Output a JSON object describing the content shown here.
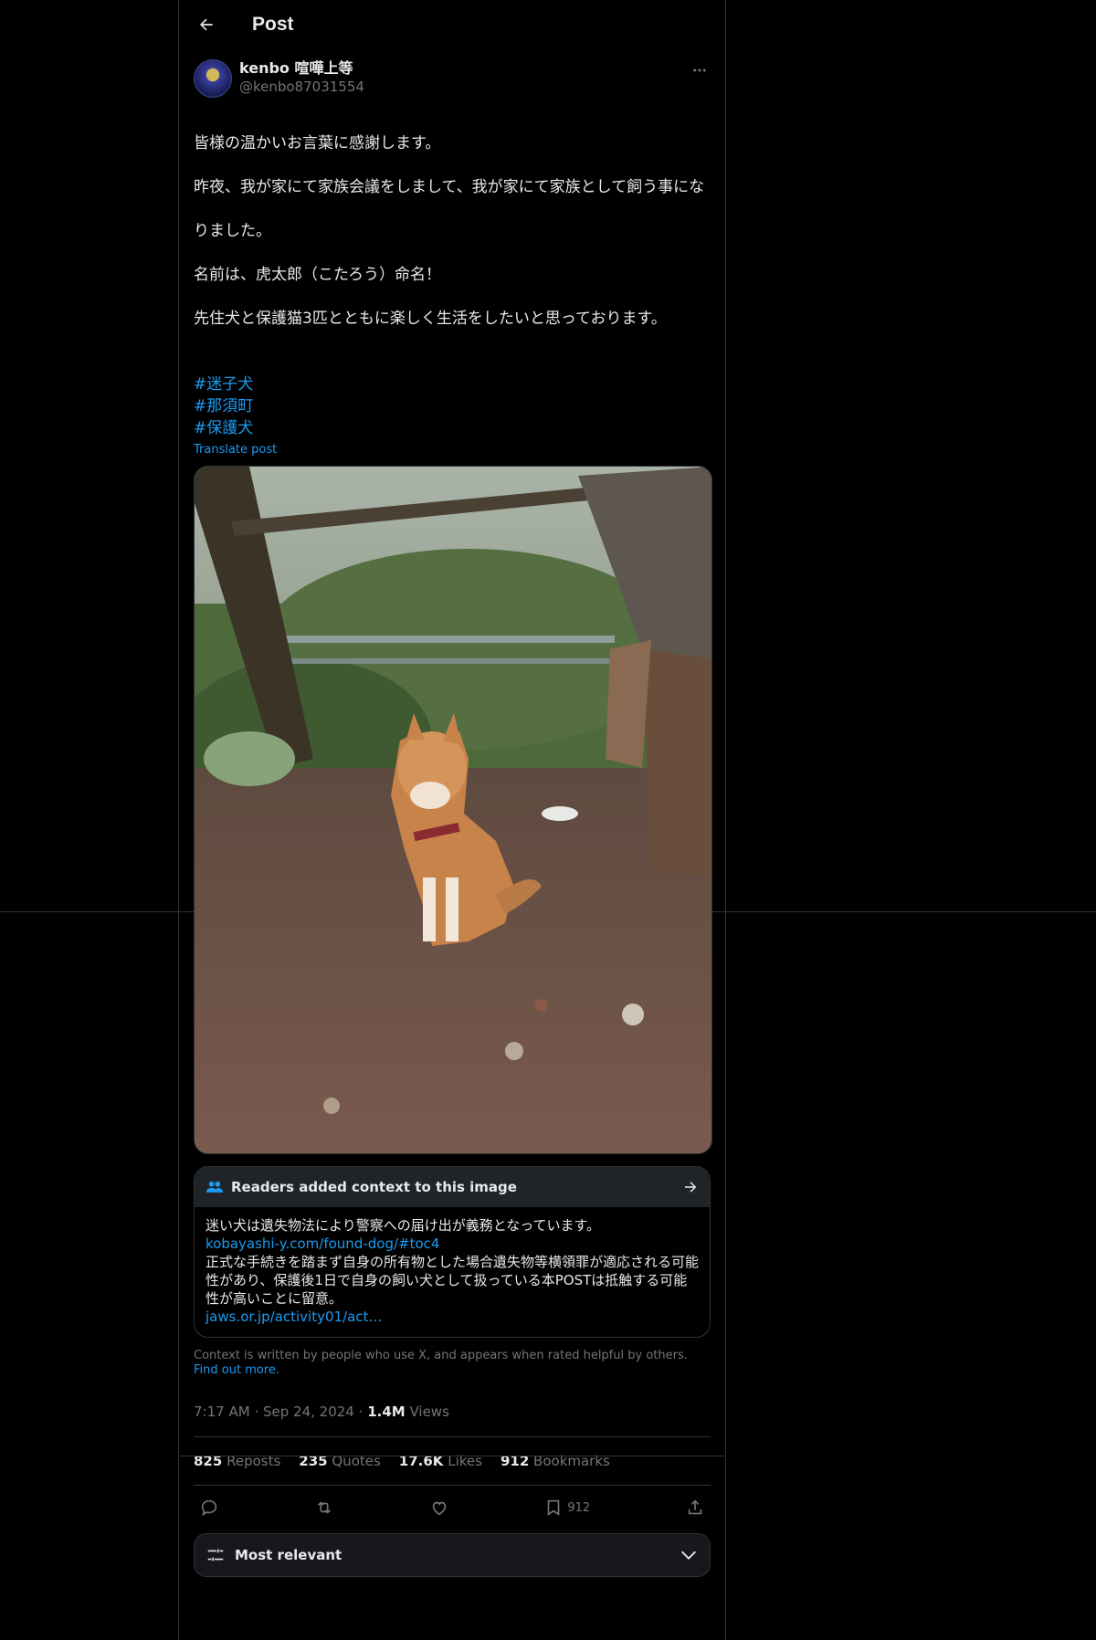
{
  "header": {
    "title": "Post"
  },
  "author": {
    "display_name": "kenbo 喧嘩上等",
    "handle": "@kenbo87031554"
  },
  "post": {
    "text_lines": [
      "皆様の温かいお言葉に感謝します。",
      "昨夜、我が家にて家族会議をしまして、我が家にて家族として飼う事にな",
      "りました。",
      "名前は、虎太郎（こたろう）命名！",
      "先住犬と保護猫3匹とともに楽しく生活をしたいと思っております。"
    ],
    "hashtags": [
      "#迷子犬",
      "#那須町",
      "#保護犬"
    ],
    "translate_label": "Translate post"
  },
  "community_note": {
    "header": "Readers added context to this image",
    "line1": "迷い犬は遺失物法により警察への届け出が義務となっています。",
    "link1": "kobayashi-y.com/found-dog/#toc4",
    "line2": "正式な手続きを踏まず自身の所有物とした場合遺失物等横領罪が適応される可能性があり、保護後1日で自身の飼い犬として扱っている本POSTは抵触する可能性が高いことに留意。",
    "link2": "jaws.or.jp/activity01/act…",
    "footer": "Context is written by people who use X, and appears when rated helpful by others.",
    "footer_link": "Find out more."
  },
  "meta": {
    "time": "7:17 AM",
    "sep1": "·",
    "date": "Sep 24, 2024",
    "sep2": "·",
    "views": "1.4M",
    "views_label": "Views"
  },
  "stats": {
    "reposts": "825",
    "reposts_label": "Reposts",
    "quotes": "235",
    "quotes_label": "Quotes",
    "likes": "17.6K",
    "likes_label": "Likes",
    "bookmarks": "912",
    "bookmarks_label": "Bookmarks"
  },
  "actions": {
    "bookmark_count": "912"
  },
  "sort": {
    "label": "Most relevant"
  },
  "colors": {
    "accent": "#1d9bf0",
    "background": "#000000",
    "border": "#2f3336",
    "muted": "#71767b"
  },
  "icons": [
    "back-arrow-icon",
    "more-icon",
    "people-icon",
    "arrow-right-icon",
    "reply-icon",
    "repost-icon",
    "like-icon",
    "bookmark-icon",
    "share-icon",
    "sliders-icon",
    "chevron-down-icon"
  ]
}
